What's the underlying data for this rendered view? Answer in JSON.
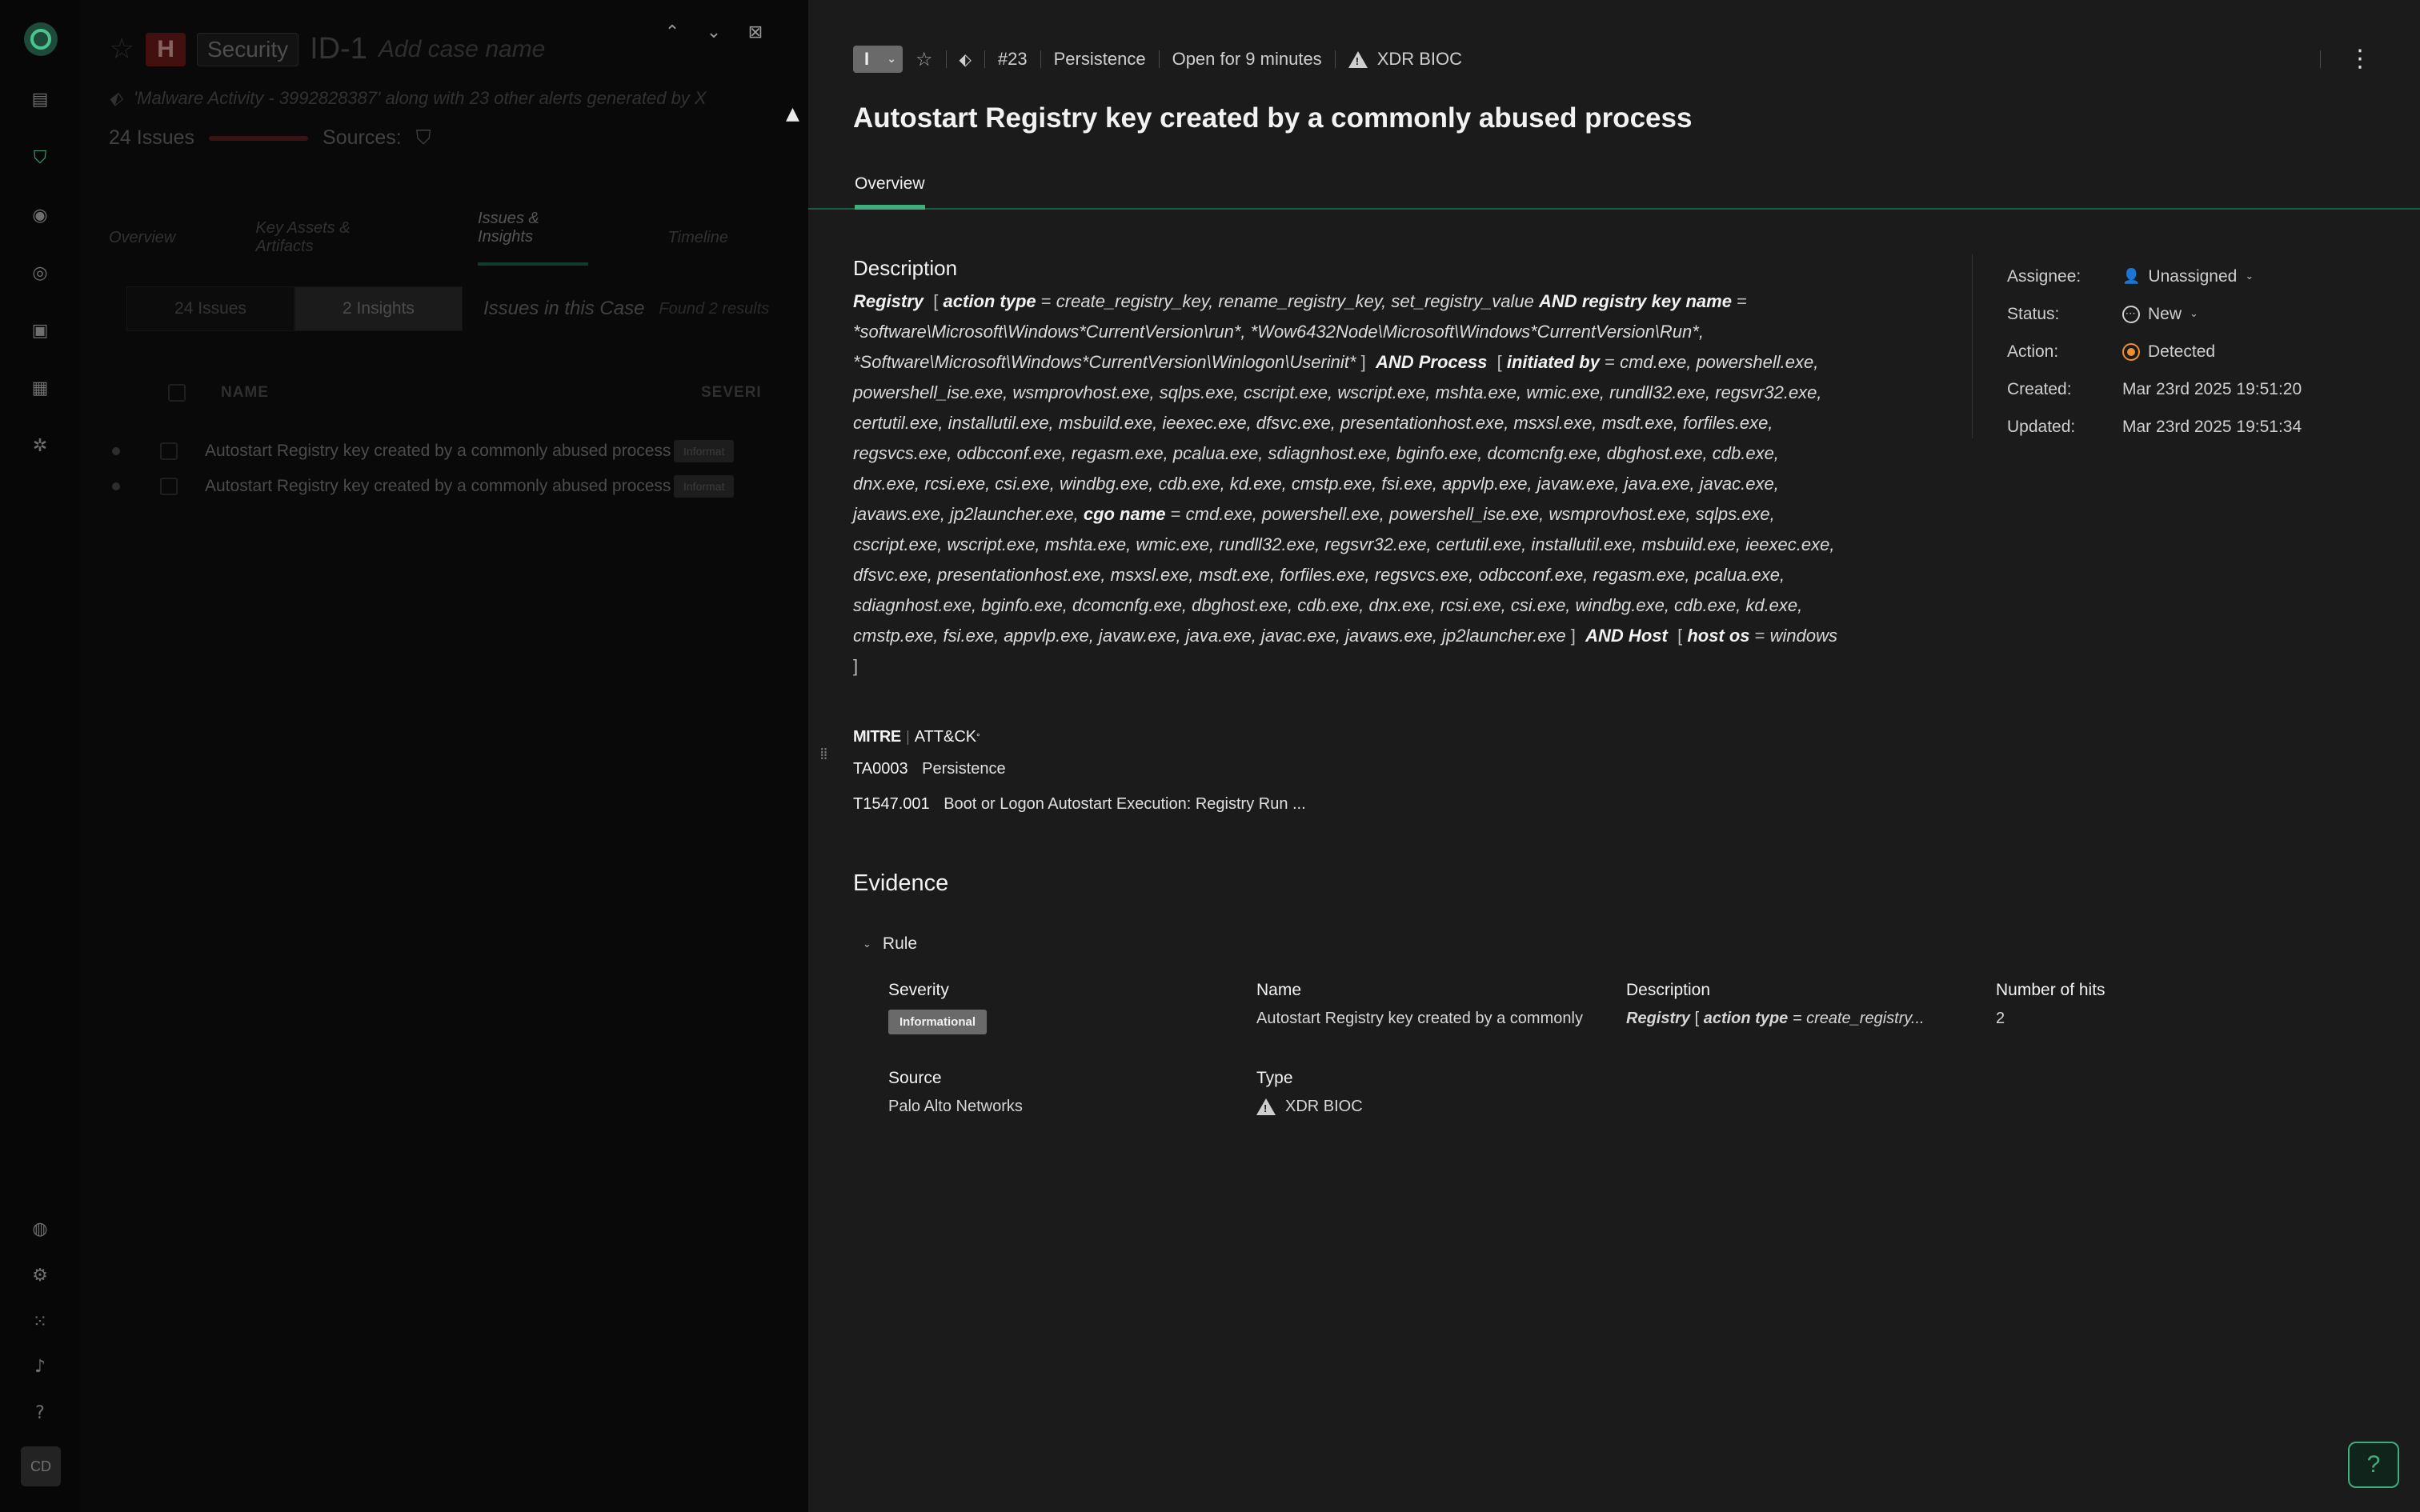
{
  "nav": {
    "icons": [
      "dashboard-icon",
      "shield-icon",
      "eye-icon",
      "target-icon",
      "clipboard-icon",
      "modules-icon",
      "network-icon",
      "cortex-icon",
      "gear-icon",
      "apps-grid-icon",
      "bell-icon",
      "help-icon"
    ],
    "avatar_initials": "CD"
  },
  "background_case": {
    "severity": "H",
    "domain": "Security",
    "case_id": "ID-1",
    "case_name_placeholder": "Add case name",
    "alert_description": "'Malware Activity - 3992828387' along with 23 other alerts generated by X",
    "issues_count": "24 Issues",
    "sources_label": "Sources:",
    "tabs": [
      "Overview",
      "Key Assets & Artifacts",
      "Issues & Insights",
      "Timeline"
    ],
    "filter_pills": [
      "24 Issues",
      "2 Insights"
    ],
    "list_title": "Issues in this Case",
    "found_text": "Found 2 results",
    "columns": [
      "NAME",
      "SEVERI"
    ],
    "rows": [
      {
        "name": "Autostart Registry key created by a commonly abused process",
        "severity": "Informat"
      },
      {
        "name": "Autostart Registry key created by a commonly abused process",
        "severity": "Informat"
      }
    ]
  },
  "header": {
    "severity_letter": "I",
    "case_number": "#23",
    "category": "Persistence",
    "open_for": "Open for 9 minutes",
    "source": "XDR BIOC"
  },
  "title": "Autostart Registry key created by a commonly abused process",
  "tabs": {
    "overview": "Overview"
  },
  "description": {
    "heading": "Description",
    "registry_label": "Registry",
    "action_type_label": "action type",
    "action_type_values": "create_registry_key, rename_registry_key, set_registry_value",
    "and_label": "AND",
    "key_name_label": "registry key name",
    "key_name_values": "*software\\Microsoft\\Windows*CurrentVersion\\run*, *Wow6432Node\\Microsoft\\Windows*CurrentVersion\\Run*, *Software\\Microsoft\\Windows*CurrentVersion\\Winlogon\\Userinit*",
    "and_process_label": "AND Process",
    "initiated_by_label": "initiated by",
    "initiated_by_values": "cmd.exe, powershell.exe, powershell_ise.exe, wsmprovhost.exe, sqlps.exe, cscript.exe, wscript.exe, mshta.exe, wmic.exe, rundll32.exe, regsvr32.exe, certutil.exe, installutil.exe, msbuild.exe, ieexec.exe, dfsvc.exe, presentationhost.exe, msxsl.exe, msdt.exe, forfiles.exe, regsvcs.exe, odbcconf.exe, regasm.exe, pcalua.exe, sdiagnhost.exe, bginfo.exe, dcomcnfg.exe, dbghost.exe, cdb.exe, dnx.exe, rcsi.exe, csi.exe, windbg.exe, cdb.exe, kd.exe, cmstp.exe, fsi.exe, appvlp.exe, javaw.exe, java.exe, javac.exe, javaws.exe, jp2launcher.exe",
    "cgo_name_label": "cgo name",
    "cgo_name_values": "cmd.exe, powershell.exe, powershell_ise.exe, wsmprovhost.exe, sqlps.exe, cscript.exe, wscript.exe, mshta.exe, wmic.exe, rundll32.exe, regsvr32.exe, certutil.exe, installutil.exe, msbuild.exe, ieexec.exe, dfsvc.exe, presentationhost.exe, msxsl.exe, msdt.exe, forfiles.exe, regsvcs.exe, odbcconf.exe, regasm.exe, pcalua.exe, sdiagnhost.exe, bginfo.exe, dcomcnfg.exe, dbghost.exe, cdb.exe, dnx.exe, rcsi.exe, csi.exe, windbg.exe, cdb.exe, kd.exe, cmstp.exe, fsi.exe, appvlp.exe, javaw.exe, java.exe, javac.exe, javaws.exe, jp2launcher.exe",
    "and_host_label": "AND Host",
    "host_os_label": "host os",
    "host_os_value": "windows",
    "eq": "=",
    "open_bracket": "[",
    "close_bracket": "]"
  },
  "meta": {
    "assignee_label": "Assignee:",
    "assignee_value": "Unassigned",
    "status_label": "Status:",
    "status_value": "New",
    "action_label": "Action:",
    "action_value": "Detected",
    "action_color": "#f08d2c",
    "created_label": "Created:",
    "created_value": "Mar 23rd 2025 19:51:20",
    "updated_label": "Updated:",
    "updated_value": "Mar 23rd 2025 19:51:34"
  },
  "mitre": {
    "brand": "MITRE",
    "framework": "ATT&CK",
    "tactic_id": "TA0003",
    "tactic_name": "Persistence",
    "technique_id": "T1547.001",
    "technique_name": "Boot or Logon Autostart Execution: Registry Run ..."
  },
  "evidence": {
    "heading": "Evidence",
    "rule_label": "Rule",
    "severity_label": "Severity",
    "severity_value": "Informational",
    "name_label": "Name",
    "name_value": "Autostart Registry key created by a commonly",
    "description_label": "Description",
    "description_registry": "Registry",
    "description_action_type": "action type",
    "description_rest": "= create_registry...",
    "hits_label": "Number of hits",
    "hits_value": "2",
    "source_label": "Source",
    "source_value": "Palo Alto Networks",
    "type_label": "Type",
    "type_value": "XDR BIOC"
  },
  "help_button_label": "?",
  "accent_color": "#3fae7c"
}
